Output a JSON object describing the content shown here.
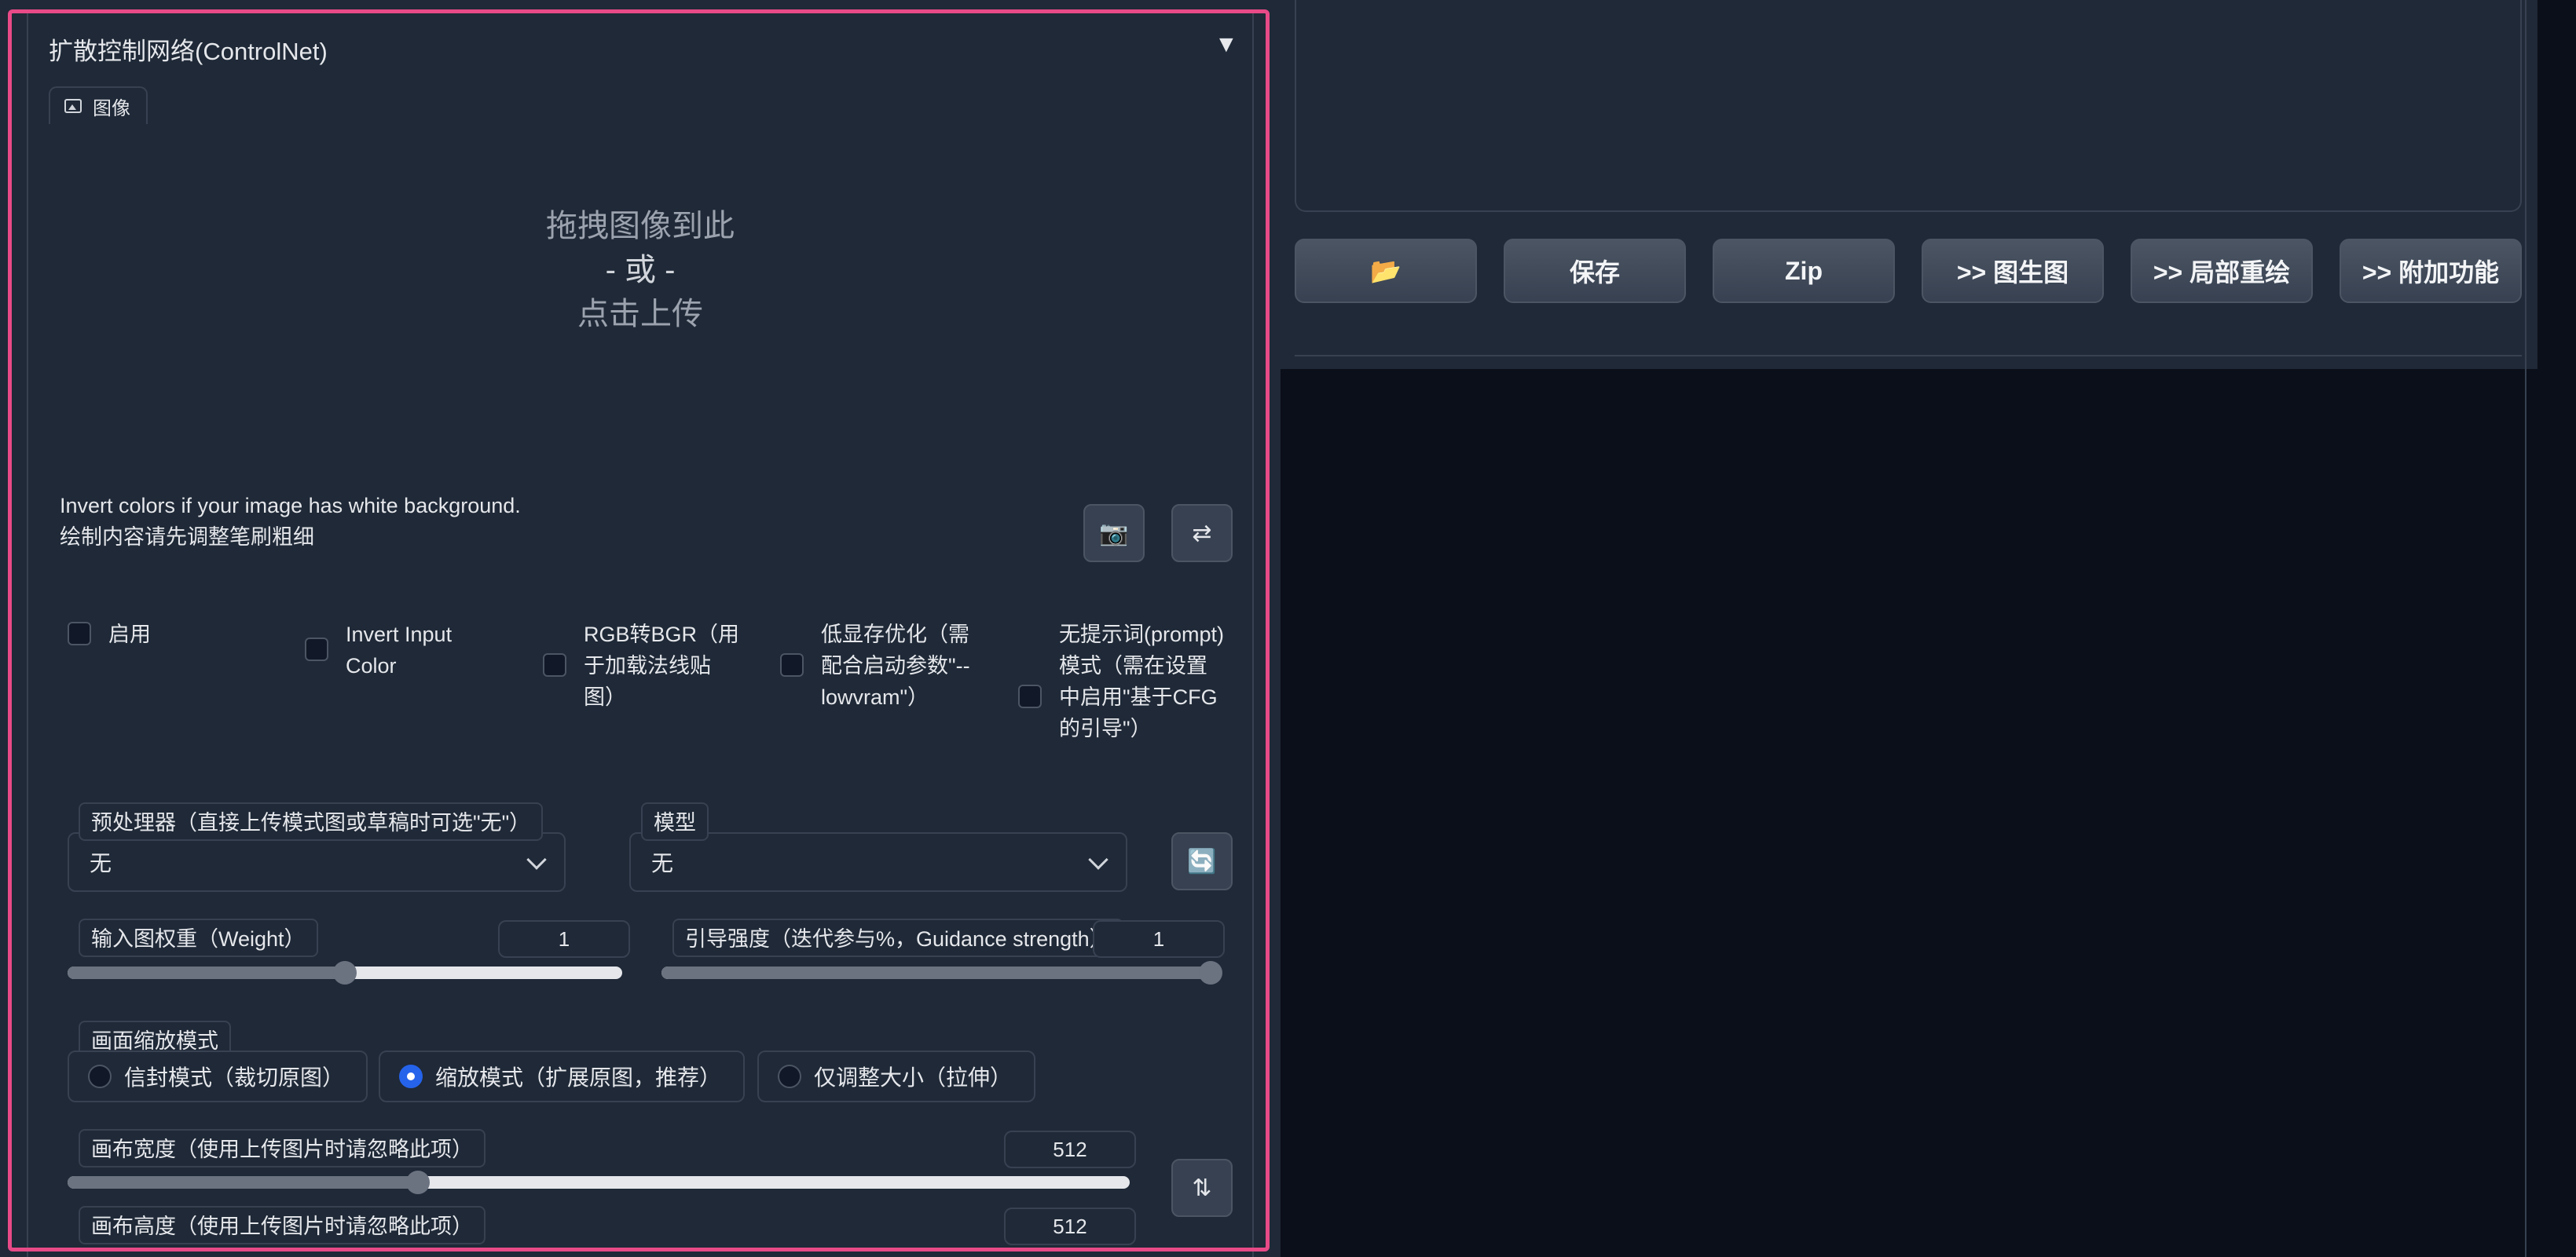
{
  "controlnet": {
    "title": "扩散控制网络(ControlNet)",
    "collapse_symbol": "▼",
    "image_tab": "图像",
    "upload": {
      "line1": "拖拽图像到此",
      "line2": "- 或 -",
      "line3": "点击上传"
    },
    "hint_line1": "Invert colors if your image has white background.",
    "hint_line2": "绘制内容请先调整笔刷粗细",
    "camera_icon": "📷",
    "swap_icon": "⇄",
    "checkboxes": [
      {
        "label": "启用",
        "checked": false
      },
      {
        "label": "Invert Input Color",
        "checked": false
      },
      {
        "label": "RGB转BGR（用于加载法线贴图）",
        "checked": false
      },
      {
        "label": "低显存优化（需配合启动参数\"--lowvram\"）",
        "checked": false
      },
      {
        "label": "无提示词(prompt)模式（需在设置中启用\"基于CFG的引导\"）",
        "checked": false
      }
    ],
    "preprocessor": {
      "label": "预处理器（直接上传模式图或草稿时可选\"无\"）",
      "value": "无"
    },
    "model": {
      "label": "模型",
      "value": "无"
    },
    "refresh_icon": "🔄",
    "weight": {
      "label": "输入图权重（Weight）",
      "value": "1",
      "min": 0,
      "max": 2,
      "fraction": 0.5
    },
    "guidance": {
      "label": "引导强度（迭代参与%，Guidance strength）",
      "value": "1",
      "min": 0,
      "max": 1,
      "fraction": 1.0
    },
    "resize_mode": {
      "label": "画面缩放模式",
      "options": [
        "信封模式（裁切原图）",
        "缩放模式（扩展原图，推荐）",
        "仅调整大小（拉伸）"
      ],
      "selected": 1
    },
    "canvas_width": {
      "label": "画布宽度（使用上传图片时请忽略此项）",
      "value": "512",
      "fraction": 0.33
    },
    "canvas_height": {
      "label": "画布高度（使用上传图片时请忽略此项）",
      "value": "512"
    },
    "swap_dims_icon": "⇅"
  },
  "output_actions": {
    "folder_icon": "📂",
    "buttons": [
      "保存",
      "Zip",
      ">> 图生图",
      ">> 局部重绘",
      ">> 附加功能"
    ]
  },
  "colors": {
    "highlight": "#e84a88",
    "accent": "#2563eb",
    "panel": "#1f2937",
    "background": "#0b0f19"
  }
}
